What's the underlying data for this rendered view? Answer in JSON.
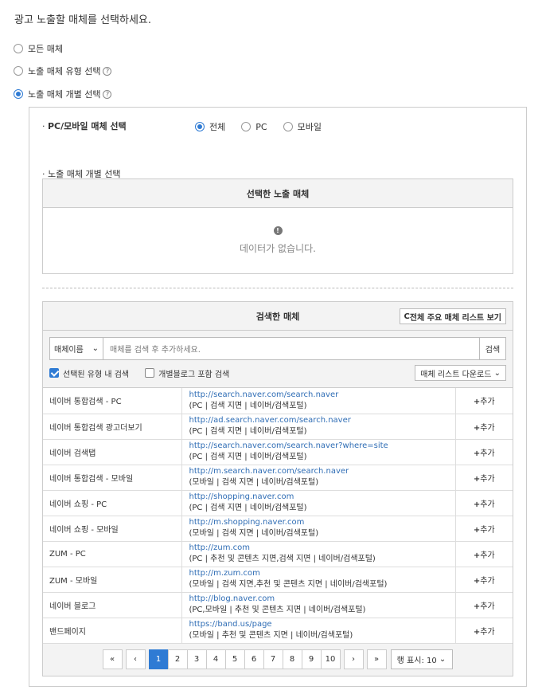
{
  "title": "광고 노출할 매체를 선택하세요.",
  "scope_options": [
    {
      "label": "모든 매체",
      "selected": false
    },
    {
      "label": "노출 매체 유형 선택",
      "selected": false,
      "help": "?"
    },
    {
      "label": "노출 매체 개별 선택",
      "selected": true,
      "help": "?"
    }
  ],
  "device_section": {
    "label": "PC/모바일 매체 선택",
    "options": [
      {
        "label": "전체",
        "selected": true
      },
      {
        "label": "PC",
        "selected": false
      },
      {
        "label": "모바일",
        "selected": false
      }
    ]
  },
  "individual_section": {
    "label": "노출 매체 개별 선택"
  },
  "selected_box": {
    "header": "선택한 노출 매체",
    "empty_icon": "!",
    "empty_text": "데이터가 없습니다."
  },
  "search_box": {
    "header": "검색한 매체",
    "view_all_button": "전체 주요 매체 리스트 보기",
    "search_type": "매체이름",
    "search_placeholder": "매체를 검색 후 추가하세요.",
    "search_button": "검색",
    "filter_in_type": {
      "label": "선택된 유형 내 검색",
      "checked": true
    },
    "filter_blog": {
      "label": "개별블로그 포함 검색",
      "checked": false
    },
    "download_button": "매체 리스트 다운로드",
    "add_label": "추가",
    "rows": [
      {
        "name": "네이버 통합검색 - PC",
        "url": "http://search.naver.com/search.naver",
        "desc": "(PC | 검색 지면 | 네이버/검색포털)"
      },
      {
        "name": "네이버 통합검색 광고더보기",
        "url": "http://ad.search.naver.com/search.naver",
        "desc": "(PC | 검색 지면 | 네이버/검색포털)"
      },
      {
        "name": "네이버 검색탭",
        "url": "http://search.naver.com/search.naver?where=site",
        "desc": "(PC | 검색 지면 | 네이버/검색포털)"
      },
      {
        "name": "네이버 통합검색 - 모바일",
        "url": "http://m.search.naver.com/search.naver",
        "desc": "(모바일 | 검색 지면 | 네이버/검색포털)"
      },
      {
        "name": "네이버 쇼핑 - PC",
        "url": "http://shopping.naver.com",
        "desc": "(PC | 검색 지면 | 네이버/검색포털)"
      },
      {
        "name": "네이버 쇼핑 - 모바일",
        "url": "http://m.shopping.naver.com",
        "desc": "(모바일 | 검색 지면 | 네이버/검색포털)"
      },
      {
        "name": "ZUM - PC",
        "url": "http://zum.com",
        "desc": "(PC | 추천 및 콘텐츠 지면,검색 지면 | 네이버/검색포털)"
      },
      {
        "name": "ZUM - 모바일",
        "url": "http://m.zum.com",
        "desc": "(모바일 | 검색 지면,추천 및 콘텐츠 지면 | 네이버/검색포털)"
      },
      {
        "name": "네이버 블로그",
        "url": "http://blog.naver.com",
        "desc": "(PC,모바일 | 추천 및 콘텐츠 지면 | 네이버/검색포털)"
      },
      {
        "name": "밴드페이지",
        "url": "https://band.us/page",
        "desc": "(모바일 | 추천 및 콘텐츠 지면 | 네이버/검색포털)"
      }
    ],
    "pager": {
      "first": "«",
      "prev": "‹",
      "next": "›",
      "last": "»",
      "pages": [
        "1",
        "2",
        "3",
        "4",
        "5",
        "6",
        "7",
        "8",
        "9",
        "10"
      ],
      "current": "1",
      "rows_label": "행 표시: 10"
    }
  },
  "colors": {
    "accent": "#2f7bd4",
    "link": "#2f6db5"
  }
}
